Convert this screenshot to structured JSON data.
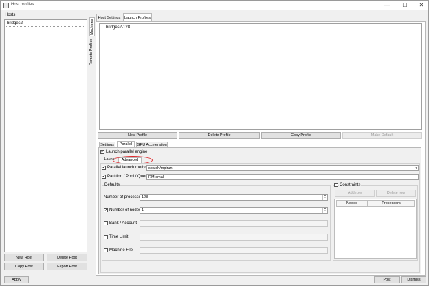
{
  "window": {
    "title": "Host profiles",
    "min": "—",
    "max": "☐",
    "close": "✕"
  },
  "hosts": {
    "group_label": "Hosts",
    "items": [
      "bridges2"
    ],
    "buttons": {
      "new": "New Host",
      "delete": "Delete Host",
      "copy": "Copy Host",
      "export": "Export Host"
    }
  },
  "side_tabs": {
    "machines": "Machines",
    "remote_profiles": "Remote Profiles"
  },
  "top_tabs": [
    "Host Settings",
    "Launch Profiles"
  ],
  "profiles": {
    "items": [
      "bridges2-128"
    ],
    "buttons": {
      "new": "New Profile",
      "delete": "Delete Profile",
      "copy": "Copy Profile",
      "default": "Make Default"
    }
  },
  "inner_tabs": [
    "Settings",
    "Parallel",
    "GPU Acceleration"
  ],
  "parallel": {
    "launch_engine_label": "Launch parallel engine",
    "launch_engine_checked": true,
    "launch_tab_partial": "Launc",
    "advanced_tab": "Advanced",
    "launch_method_label": "Parallel launch method",
    "launch_method_value": "sbatch/mpirun",
    "partition_label": "Partition / Pool / Queue",
    "partition_value": "RM-small",
    "defaults_label": "Defaults",
    "processors_label": "Number of processors",
    "processors_value": "128",
    "nodes_label": "Number of nodes",
    "nodes_value": "1",
    "bank_label": "Bank / Account",
    "time_label": "Time Limit",
    "machine_file_label": "Machine File",
    "constraints_label": "Constraints",
    "add_row": "Add row",
    "delete_row": "Delete row",
    "col_nodes": "Nodes",
    "col_processors": "Processors"
  },
  "footer": {
    "apply": "Apply",
    "post": "Post",
    "dismiss": "Dismiss"
  },
  "colors": {
    "highlight_oval": "#e0282c"
  }
}
